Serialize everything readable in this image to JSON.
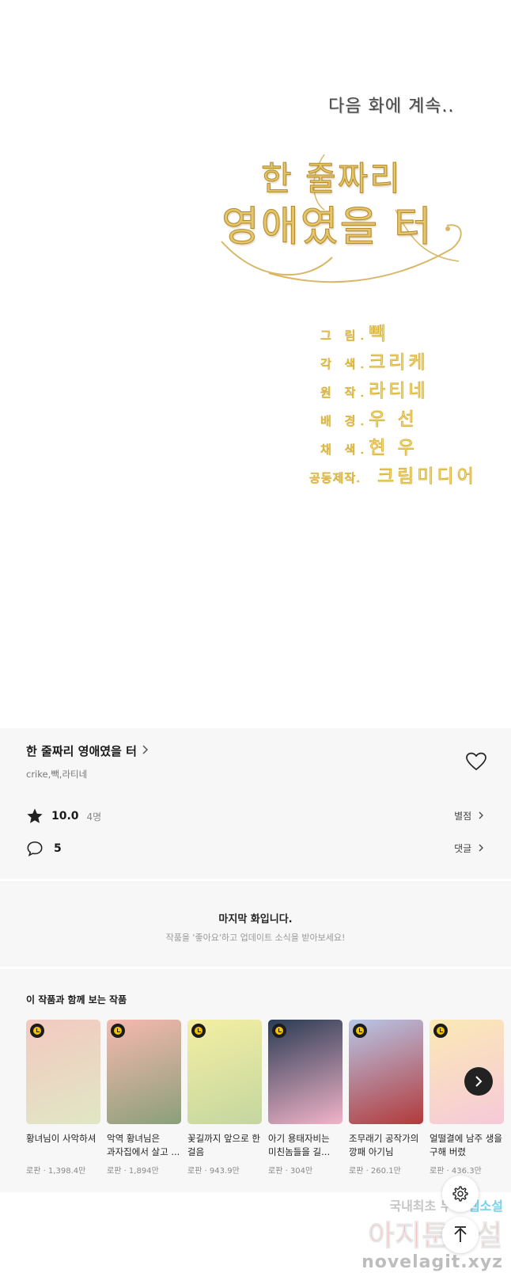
{
  "panel": {
    "continue_text": "다음 화에 계속..",
    "logo_line1": "한 줄짜리",
    "logo_line2": "영애였을 터",
    "credits": [
      {
        "role": "그 림.",
        "name": "빽"
      },
      {
        "role": "각 색.",
        "name": "크리케"
      },
      {
        "role": "원 작.",
        "name": "라티네"
      },
      {
        "role": "배 경.",
        "name": "우 선"
      },
      {
        "role": "채 색.",
        "name": "현 우"
      },
      {
        "role": "공동제작.",
        "name": "크림미디어"
      }
    ]
  },
  "info": {
    "title": "한 줄짜리 영애였을 터",
    "authors": "crike,빽,라티네",
    "rating": "10.0",
    "rating_count": "4명",
    "rating_link": "별점",
    "comment_count": "5",
    "comment_link": "댓글",
    "icons": [
      "chevron-right-icon",
      "heart-icon",
      "star-icon",
      "comment-icon"
    ]
  },
  "last_episode": {
    "title": "마지막 화입니다.",
    "subtitle": "작품을 '좋아요'하고 업데이트 소식을 받아보세요!"
  },
  "recommendations": {
    "title": "이 작품과 함께 보는 작품",
    "items": [
      {
        "name": "황녀님이 사악하셔",
        "meta": "로판 · 1,398.4만",
        "colors": [
          "#f3c9c0",
          "#e0e7c5"
        ]
      },
      {
        "name": "악역 황녀님은 과자집에서 살고 ...",
        "meta": "로판 · 1,894만",
        "colors": [
          "#f6b8b0",
          "#8aa07a"
        ]
      },
      {
        "name": "꽃길까지 앞으로 한 걸음",
        "meta": "로판 · 943.9만",
        "colors": [
          "#f4efa2",
          "#c4d6a0"
        ]
      },
      {
        "name": "아기 용태자비는 미친놈들을 길...",
        "meta": "로판 · 304만",
        "colors": [
          "#2a3b54",
          "#f1b3c8"
        ]
      },
      {
        "name": "조무래기 공작가의 깡패 아기님",
        "meta": "로판 · 260.1만",
        "colors": [
          "#b8c6e8",
          "#b23a3a"
        ]
      },
      {
        "name": "얼떨결에 남주 생을 구해 버렸",
        "meta": "로판 · 436.3만",
        "colors": [
          "#fbe9b5",
          "#f6c9d9"
        ]
      }
    ]
  },
  "watermark": {
    "line1_prefix": "국내최초 무료",
    "line1_highlight": "웹소설",
    "line2": "아지툰소설",
    "line3": "novelagit.xyz"
  },
  "colors": {
    "gold": "#e3c56a",
    "background": "#f7f7f7",
    "dark": "#222222"
  }
}
